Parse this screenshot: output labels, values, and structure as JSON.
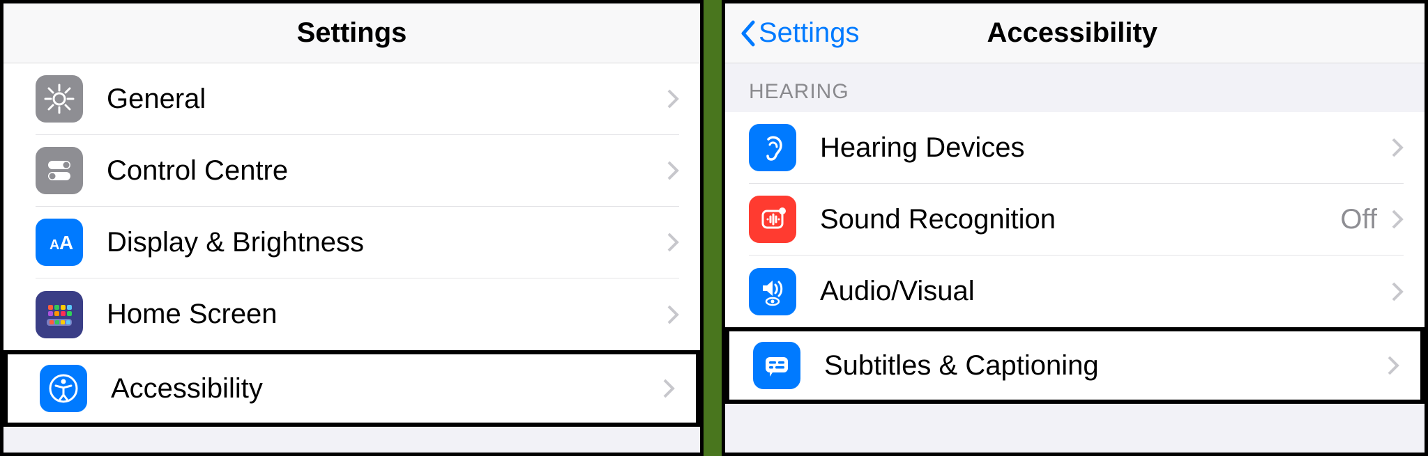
{
  "left": {
    "title": "Settings",
    "rows": [
      {
        "label": "General"
      },
      {
        "label": "Control Centre"
      },
      {
        "label": "Display & Brightness"
      },
      {
        "label": "Home Screen"
      },
      {
        "label": "Accessibility"
      }
    ]
  },
  "right": {
    "back": "Settings",
    "title": "Accessibility",
    "section": "HEARING",
    "rows": [
      {
        "label": "Hearing Devices"
      },
      {
        "label": "Sound Recognition",
        "value": "Off"
      },
      {
        "label": "Audio/Visual"
      },
      {
        "label": "Subtitles & Captioning"
      }
    ]
  }
}
